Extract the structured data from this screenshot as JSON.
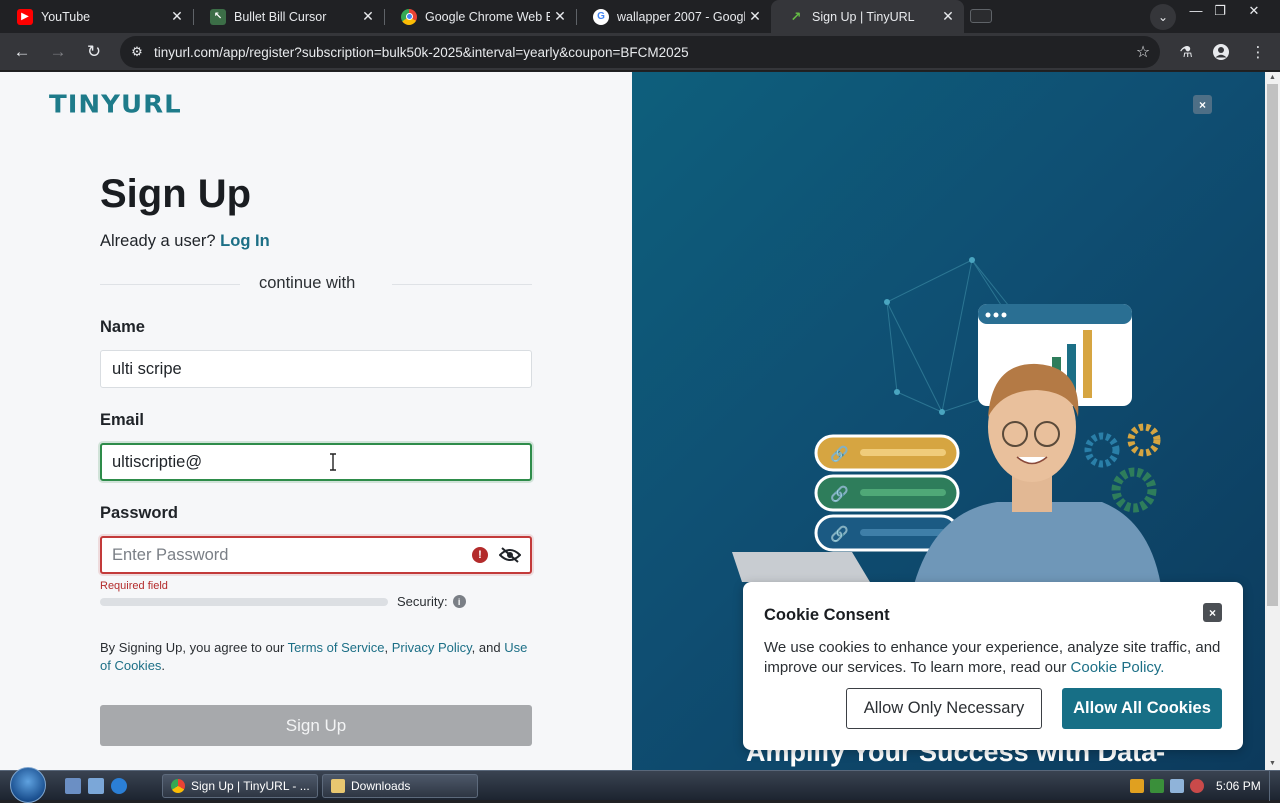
{
  "browser": {
    "tabs": [
      {
        "title": "YouTube",
        "icon": "youtube-icon",
        "color": "#ff0000"
      },
      {
        "title": "Bullet Bill Cursor",
        "icon": "cursor-extension-icon",
        "color": "#3c6e47"
      },
      {
        "title": "Google Chrome Web Br",
        "icon": "chrome-icon",
        "color": "#4285f4"
      },
      {
        "title": "wallapper 2007 - Googl",
        "icon": "google-icon",
        "color": "#ffffff"
      },
      {
        "title": "Sign Up | TinyURL",
        "icon": "tinyurl-icon",
        "color": "#65bc45",
        "active": true
      }
    ],
    "url": "tinyurl.com/app/register?subscription=bulk50k-2025&interval=yearly&coupon=BFCM2025"
  },
  "page": {
    "logo": "TINYURL",
    "heading": "Sign Up",
    "already_text": "Already a user?",
    "login_link": "Log In",
    "continue_with": "continue with",
    "name_label": "Name",
    "name_value": "ulti scripe",
    "email_label": "Email",
    "email_value": "ultiscriptie@",
    "password_label": "Password",
    "password_placeholder": "Enter Password",
    "required_text": "Required field",
    "security_label": "Security:",
    "password_strength": 0,
    "terms_prefix": "By Signing Up, you agree to our",
    "terms_link": "Terms of Service",
    "privacy_link": "Privacy Policy",
    "and_text": ", and",
    "cookies_link": "Use of Cookies",
    "signup_button": "Sign Up",
    "accent_color": "#1c6f86"
  },
  "promo": {
    "close_label": "×",
    "headline": "Amplify Your Success with Data-"
  },
  "cookie": {
    "title": "Cookie Consent",
    "text": "We use cookies to enhance your experience, analyze site traffic, and improve our services. To learn more, read our",
    "policy_link": "Cookie Policy.",
    "btn_necessary": "Allow Only Necessary",
    "btn_all": "Allow All Cookies",
    "close_label": "×"
  },
  "taskbar": {
    "tasks": [
      "Sign Up | TinyURL - ...",
      "Downloads"
    ],
    "clock": "5:06 PM"
  }
}
